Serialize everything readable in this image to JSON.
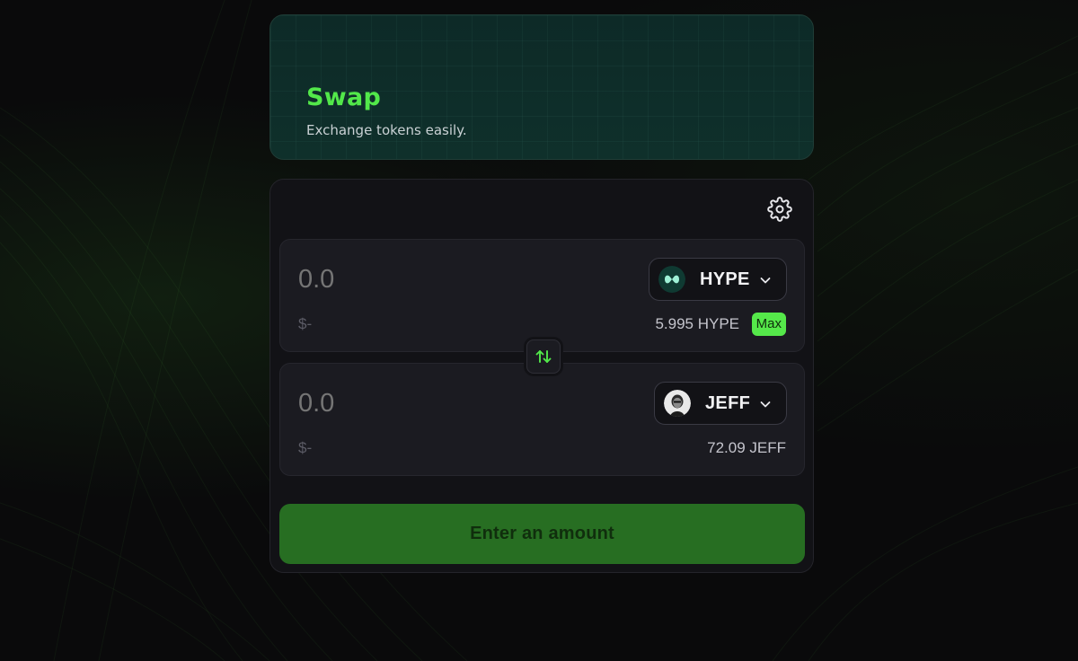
{
  "hero": {
    "title": "Swap",
    "subtitle": "Exchange tokens easily."
  },
  "swap": {
    "from": {
      "amount_placeholder": "0.0",
      "usd_value": "$-",
      "token_symbol": "HYPE",
      "balance": "5.995 HYPE",
      "max_label": "Max",
      "icon": "hype-token-icon"
    },
    "to": {
      "amount_placeholder": "0.0",
      "usd_value": "$-",
      "token_symbol": "JEFF",
      "balance": "72.09 JEFF",
      "icon": "jeff-token-avatar"
    },
    "submit_label": "Enter an amount"
  },
  "colors": {
    "accent": "#52e84a",
    "button": "#276e22",
    "panel": "#121216",
    "field": "#1b1b21"
  }
}
